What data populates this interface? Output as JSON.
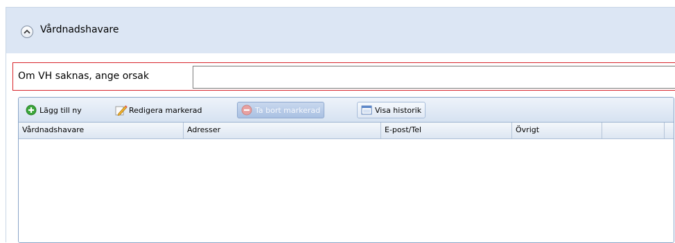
{
  "section": {
    "title": "Vårdnadshavare"
  },
  "reason": {
    "label": "Om VH saknas, ange orsak",
    "value": "",
    "placeholder": ""
  },
  "toolbar": {
    "add_label": "Lägg till ny",
    "edit_label": "Redigera markerad",
    "delete_label": "Ta bort markerad",
    "history_label": "Visa historik"
  },
  "grid": {
    "columns": [
      "Vårdnadshavare",
      "Adresser",
      "E-post/Tel",
      "Övrigt",
      ""
    ],
    "rows": []
  },
  "colors": {
    "header_bg": "#dce6f4",
    "required_border": "#d8242a",
    "grid_border": "#8aa5c8",
    "add_icon": "#3aa63a",
    "delete_icon_disabled": "#e8a0a0"
  },
  "icons": {
    "collapse": "chevron-up-icon",
    "add": "plus-circle-icon",
    "edit": "pencil-icon",
    "delete": "minus-circle-icon",
    "history": "window-icon"
  }
}
